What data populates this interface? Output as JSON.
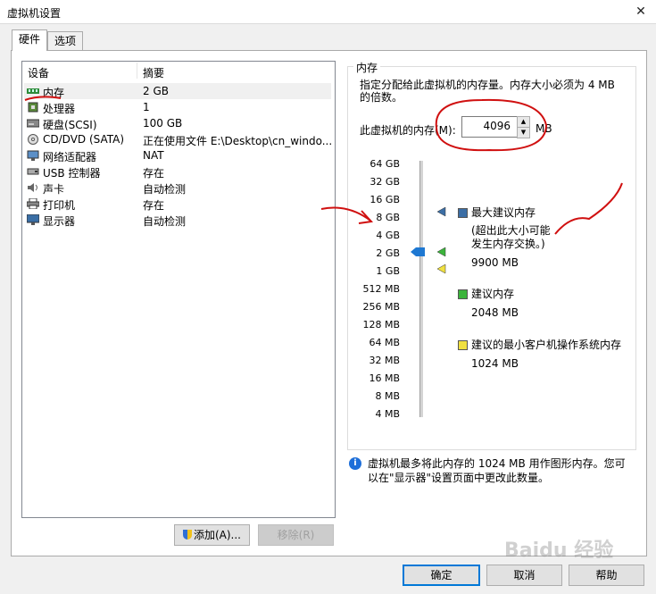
{
  "window": {
    "title": "虚拟机设置",
    "close_glyph": "✕"
  },
  "tabs": [
    {
      "label": "硬件",
      "selected": true
    },
    {
      "label": "选项",
      "selected": false
    }
  ],
  "device_list": {
    "headers": [
      "设备",
      "摘要"
    ],
    "rows": [
      {
        "device": "内存",
        "summary": "2 GB",
        "icon": "memory-icon",
        "selected": true
      },
      {
        "device": "处理器",
        "summary": "1",
        "icon": "cpu-icon"
      },
      {
        "device": "硬盘(SCSI)",
        "summary": "100 GB",
        "icon": "harddisk-icon"
      },
      {
        "device": "CD/DVD (SATA)",
        "summary": "正在使用文件 E:\\Desktop\\cn_windo...",
        "icon": "cdrom-icon"
      },
      {
        "device": "网络适配器",
        "summary": "NAT",
        "icon": "network-icon"
      },
      {
        "device": "USB 控制器",
        "summary": "存在",
        "icon": "usb-icon"
      },
      {
        "device": "声卡",
        "summary": "自动检测",
        "icon": "sound-icon"
      },
      {
        "device": "打印机",
        "summary": "存在",
        "icon": "printer-icon"
      },
      {
        "device": "显示器",
        "summary": "自动检测",
        "icon": "display-icon"
      }
    ]
  },
  "list_buttons": {
    "add": "添加(A)...",
    "remove": "移除(R)"
  },
  "memory": {
    "group_title": "内存",
    "description": "指定分配给此虚拟机的内存量。内存大小必须为 4 MB 的倍数。",
    "field_label": "此虚拟机的内存(M):",
    "field_value": "4096",
    "unit": "MB",
    "scale_labels": [
      "64 GB",
      "32 GB",
      "16 GB",
      "8 GB",
      "4 GB",
      "2 GB",
      "1 GB",
      "512 MB",
      "256 MB",
      "128 MB",
      "64 MB",
      "32 MB",
      "16 MB",
      "8 MB",
      "4 MB"
    ],
    "legend": {
      "max_title": "最大建议内存",
      "max_note_1": "(超出此大小可能",
      "max_note_2": "发生内存交换。)",
      "max_value": "9900 MB",
      "rec_title": "建议内存",
      "rec_value": "2048 MB",
      "min_title": "建议的最小客户机操作系统内存",
      "min_value": "1024 MB"
    },
    "colors": {
      "max": "#3c6ea5",
      "rec": "#3cb43c",
      "min": "#f0e040",
      "slider": "#1e78d2"
    },
    "note": "虚拟机最多将此内存的 1024 MB 用作图形内存。您可以在\"显示器\"设置页面中更改此数量。"
  },
  "dialog_buttons": {
    "ok": "确定",
    "cancel": "取消",
    "help": "帮助"
  },
  "watermark": "Baidu 经验"
}
